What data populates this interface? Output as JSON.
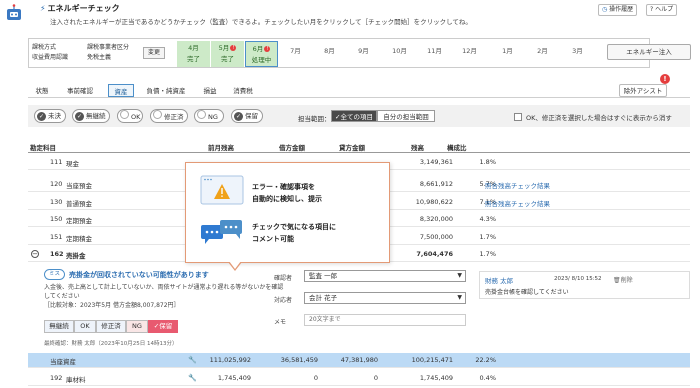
{
  "header": {
    "title": "エネルギーチェック",
    "description": "注入されたエネルギーが正当であるかどうかチェック（監査）できるよ。チェックしたい月をクリックして［チェック開始］をクリックしてね。",
    "history_button": "操作履歴",
    "help_button": "ヘルプ"
  },
  "status": {
    "method_label": "課税方式",
    "method_value": "収益費用認識",
    "category_label": "課税事業者区分",
    "category_value": "免税主義",
    "change_button": "変更",
    "months": [
      {
        "name": "4月",
        "status": "完了",
        "state": "done"
      },
      {
        "name": "5月",
        "status": "完了",
        "state": "done",
        "badge": "!"
      },
      {
        "name": "6月",
        "status": "処理中",
        "state": "current",
        "badge": "!"
      },
      {
        "name": "7月",
        "status": "",
        "state": "todo"
      },
      {
        "name": "8月",
        "status": "",
        "state": "todo"
      },
      {
        "name": "9月",
        "status": "",
        "state": "todo"
      },
      {
        "name": "10月",
        "status": "",
        "state": "todo"
      },
      {
        "name": "11月",
        "status": "",
        "state": "todo"
      },
      {
        "name": "12月",
        "status": "",
        "state": "todo"
      },
      {
        "name": "1月",
        "status": "",
        "state": "todo"
      },
      {
        "name": "2月",
        "status": "",
        "state": "todo"
      },
      {
        "name": "3月",
        "status": "",
        "state": "todo"
      }
    ],
    "energy_button": "エネルギー注入"
  },
  "tabs": [
    "状態",
    "事前確認",
    "資産",
    "負債・純資産",
    "損益",
    "消費税"
  ],
  "active_tab": 2,
  "assist": {
    "label": "除外アシスト",
    "badge": "!"
  },
  "filters": {
    "chips": [
      {
        "label": "未決",
        "checked": true
      },
      {
        "label": "無継続",
        "checked": true
      },
      {
        "label": "OK",
        "checked": false
      },
      {
        "label": "修正済",
        "checked": false
      },
      {
        "label": "NG",
        "checked": false
      },
      {
        "label": "保留",
        "checked": true
      }
    ],
    "scope_label": "担当範囲：",
    "scope_all": "全ての項目",
    "scope_mine": "自分の担当範囲",
    "ok_hide_label": "OK、修正済を選択した場合はすぐに表示から消す"
  },
  "table": {
    "headers": [
      "勘定科目",
      "前月残高",
      "借方金額",
      "貸方金額",
      "残高",
      "構成比"
    ],
    "rows": [
      {
        "code": "111",
        "name": "現金",
        "balance": "3,149,361",
        "ratio": "1.8%",
        "link": ""
      },
      {
        "code": "120",
        "name": "当座預金",
        "balance": "8,661,912",
        "ratio": "5.7%",
        "link": "照合残高チェック結果"
      },
      {
        "code": "130",
        "name": "普通預金",
        "balance": "10,980,622",
        "ratio": "7.1%",
        "link": "照合残高チェック結果"
      },
      {
        "code": "150",
        "name": "定期預金",
        "balance": "8,320,000",
        "ratio": "4.3%",
        "link": ""
      },
      {
        "code": "151",
        "name": "定期積金",
        "balance": "7,500,000",
        "ratio": "1.7%",
        "link": ""
      },
      {
        "code": "162",
        "name": "売掛金",
        "balance": "7,604,476",
        "ratio": "1.7%",
        "link": ""
      }
    ],
    "subtotal": {
      "name": "当座資産",
      "prev": "111,025,992",
      "debit": "36,581,459",
      "credit": "47,381,980",
      "balance": "100,215,471",
      "ratio": "22.2%"
    },
    "last_row": {
      "code": "192",
      "name": "庫材料",
      "prev": "1,745,409",
      "debit": "0",
      "credit": "0",
      "balance": "1,745,409",
      "ratio": "0.4%"
    }
  },
  "popover": {
    "item1": "エラー・確認事項を\n自動的に検知し、提示",
    "item2": "チェックで気になる項目に\nコメント可能"
  },
  "detail": {
    "tag": "ミス",
    "title": "売掛金が回収されていない可能性があります",
    "description": "入金後、売上高として計上していないか、両依サイトが通常より遅れる等がないかを確認してください",
    "sub_note": "［比較対象：2023年5月 借方金額8,007,872円］",
    "buttons": [
      "無継続",
      "OK",
      "修正済",
      "NG",
      "保留"
    ],
    "confirm": "最終確認：財務 太郎（2023年10月25日 14時13分）",
    "confirmer_label": "確認者",
    "confirmer_value": "監査 一郎",
    "assignee_label": "対応者",
    "assignee_value": "会計 花子",
    "memo_label": "メモ",
    "memo_placeholder": "20文字まで",
    "comment_author": "財務 太郎",
    "comment_date": "2023/ 8/10 15:52",
    "comment_delete": "削除",
    "comment_text": "売掛金台帳を確認してください"
  }
}
